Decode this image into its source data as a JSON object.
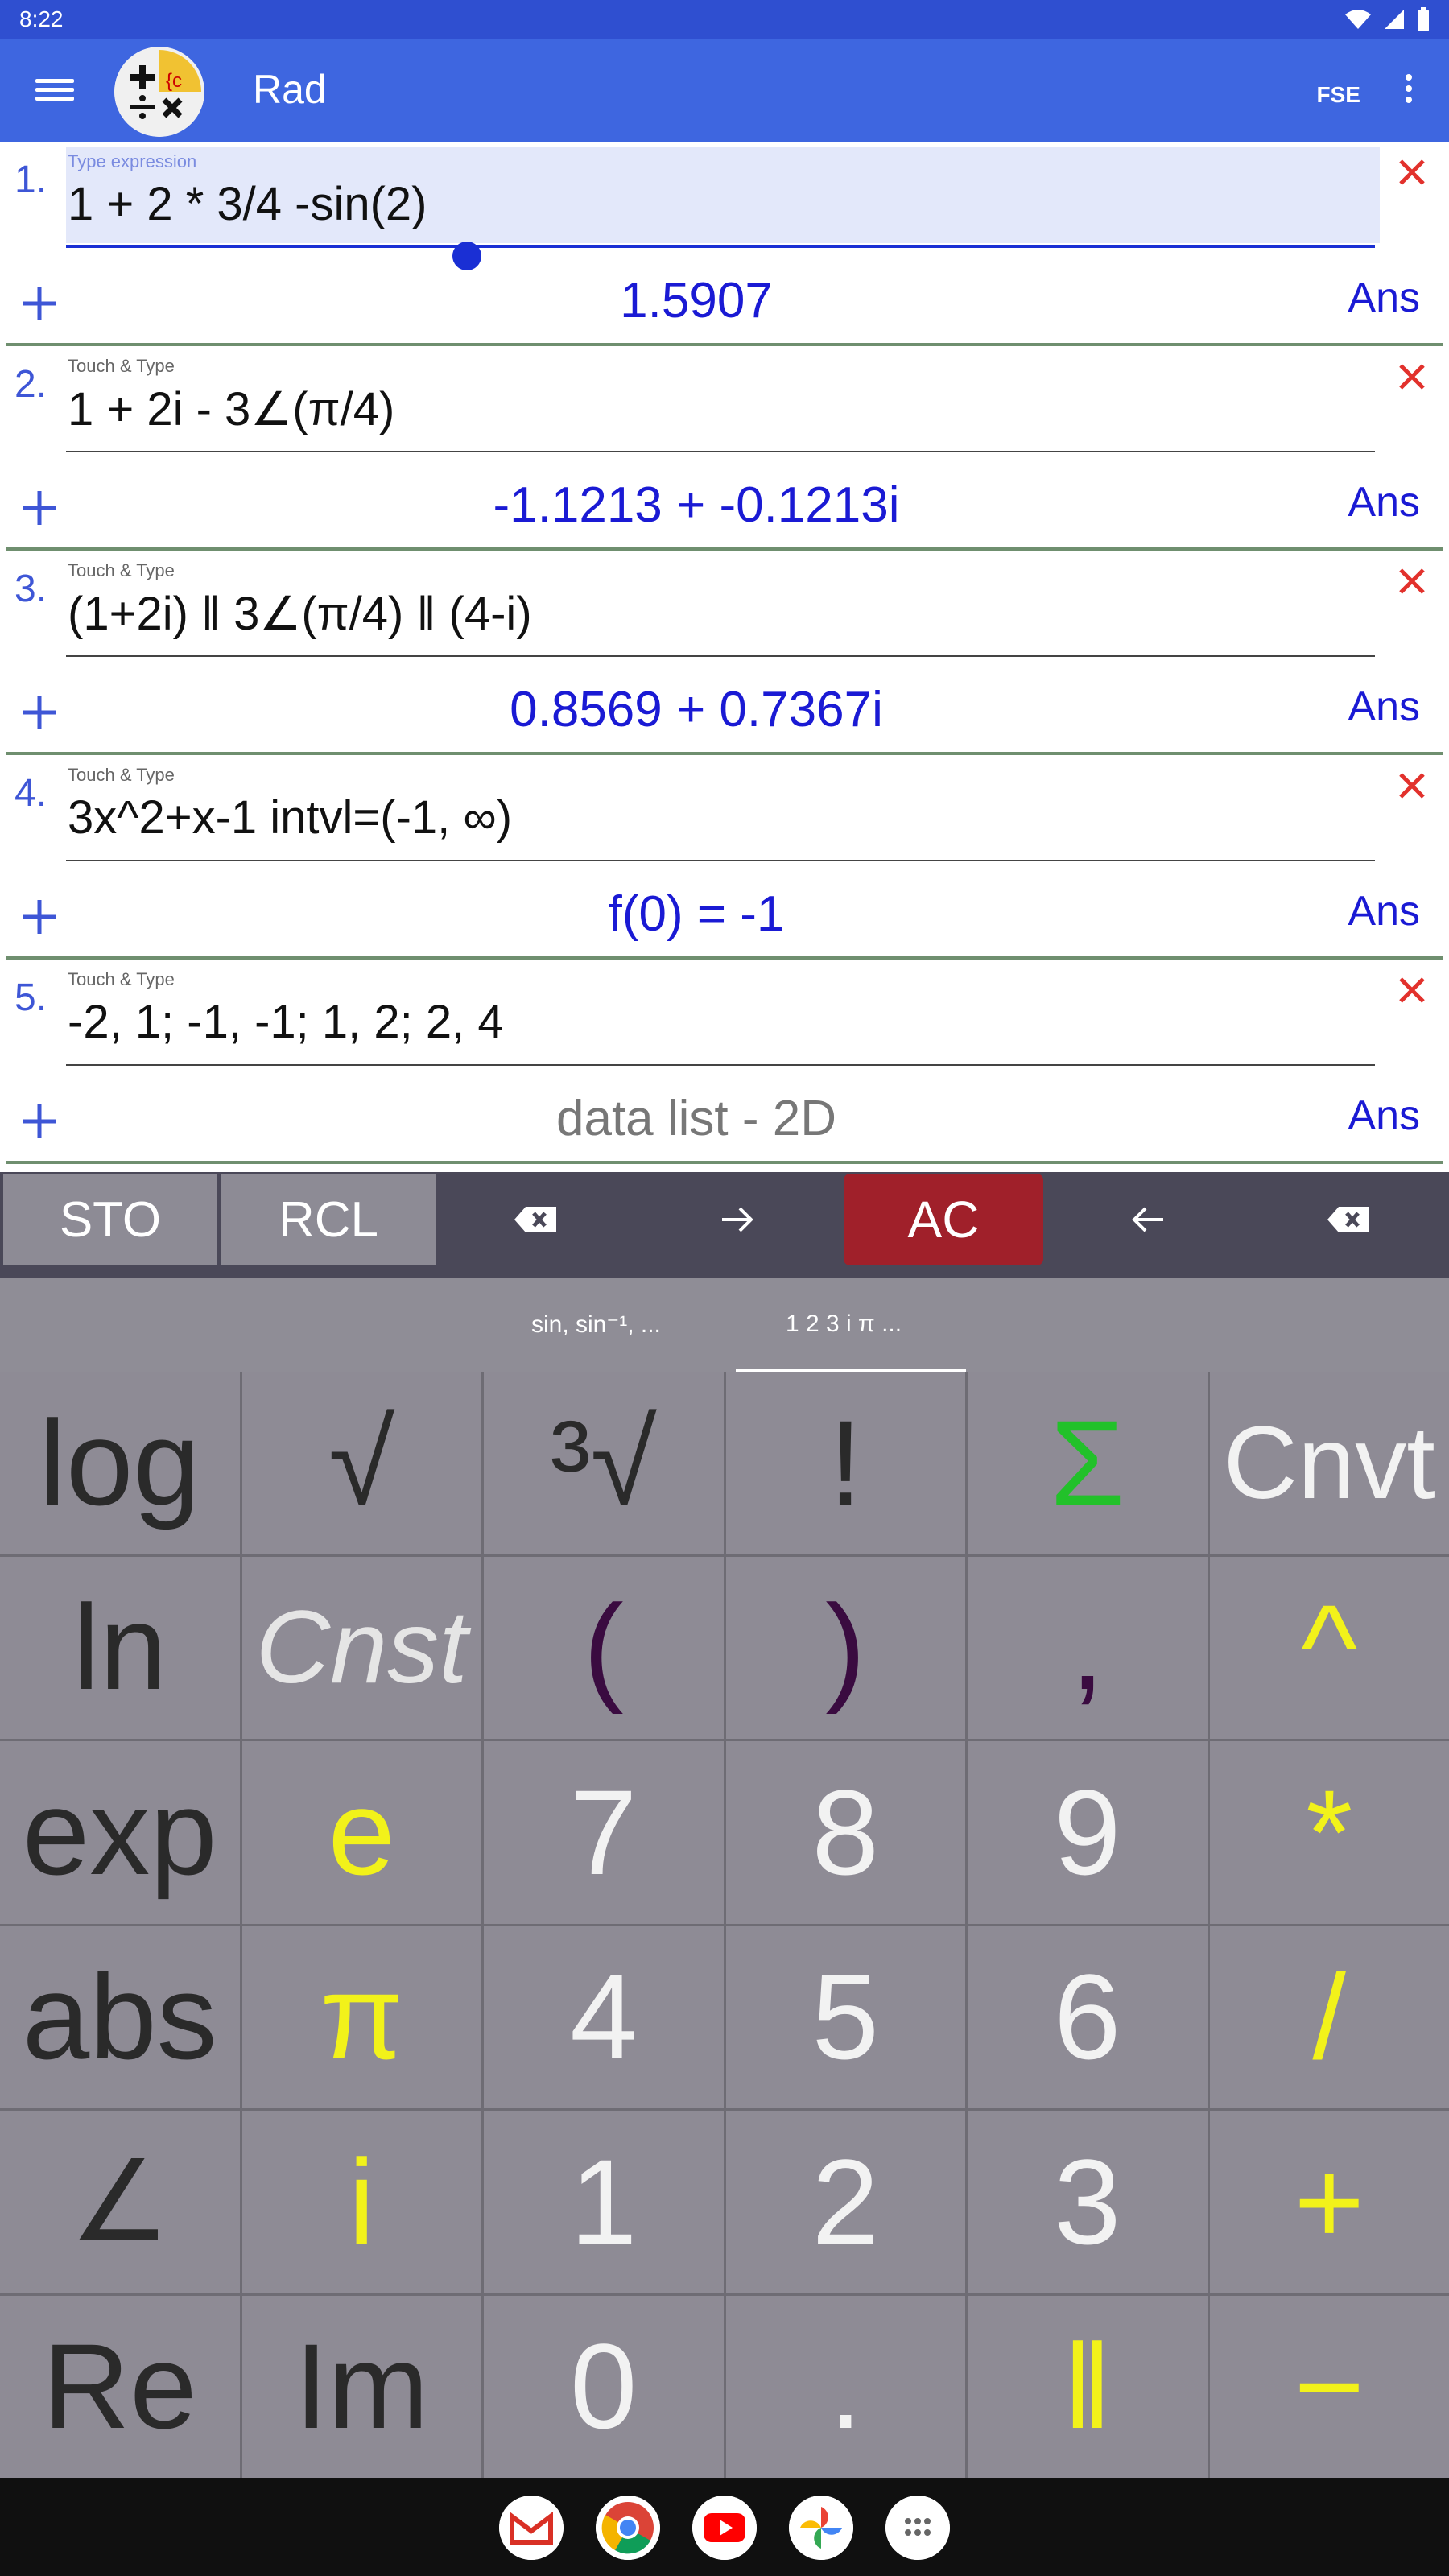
{
  "status_bar": {
    "time": "8:22"
  },
  "app_bar": {
    "title": "Rad",
    "fse_label": "FSE"
  },
  "colors": {
    "app_bar": "#3e66e0",
    "status_bar": "#2f4fd0",
    "result_text": "#1a1ad4",
    "ac_button": "#a0202a",
    "keypad_bg": "#8e8b95",
    "accent_yellow": "#f2f21a",
    "sigma_green": "#22c12a"
  },
  "expressions": [
    {
      "num": "1.",
      "hint": "Type expression",
      "expr": "1 + 2 * 3/4 -sin(2)",
      "result": "1.5907",
      "ans": "Ans"
    },
    {
      "num": "2.",
      "hint": "Touch & Type",
      "expr": "1 + 2i - 3∠(π/4)",
      "result": "-1.1213 + -0.1213i",
      "ans": "Ans"
    },
    {
      "num": "3.",
      "hint": "Touch & Type",
      "expr": "(1+2i) ǁ 3∠(π/4) ǁ (4-i)",
      "result": "0.8569 + 0.7367i",
      "ans": "Ans"
    },
    {
      "num": "4.",
      "hint": "Touch & Type",
      "expr": "3x^2+x-1   intvl=(-1, ∞)",
      "result": "f(0) = -1",
      "ans": "Ans"
    },
    {
      "num": "5.",
      "hint": "Touch & Type",
      "expr": "-2, 1;  -1, -1;  1, 2;  2, 4",
      "result": "data list - 2D",
      "ans": "Ans"
    }
  ],
  "toolbar": {
    "sto": "STO",
    "rcl": "RCL",
    "ac": "AC"
  },
  "tabs": {
    "trig": "sin, sin⁻¹, ...",
    "nums": "1 2 3 i π ..."
  },
  "keys": {
    "log": "log",
    "sqrt": "√",
    "cbrt": "³√",
    "fact": "!",
    "sigma": "Σ",
    "cnvt": "Cnvt",
    "ln": "ln",
    "cnst": "Cnst",
    "lparen": "(",
    "rparen": ")",
    "comma": ",",
    "pow": "^",
    "exp": "exp",
    "e": "e",
    "k7": "7",
    "k8": "8",
    "k9": "9",
    "mul": "*",
    "abs": "abs",
    "pi": "π",
    "k4": "4",
    "k5": "5",
    "k6": "6",
    "div": "/",
    "angle": "∠",
    "i": "i",
    "k1": "1",
    "k2": "2",
    "k3": "3",
    "plus": "+",
    "re": "Re",
    "im": "Im",
    "k0": "0",
    "dot": ".",
    "par": "ǁ",
    "minus": "−"
  }
}
